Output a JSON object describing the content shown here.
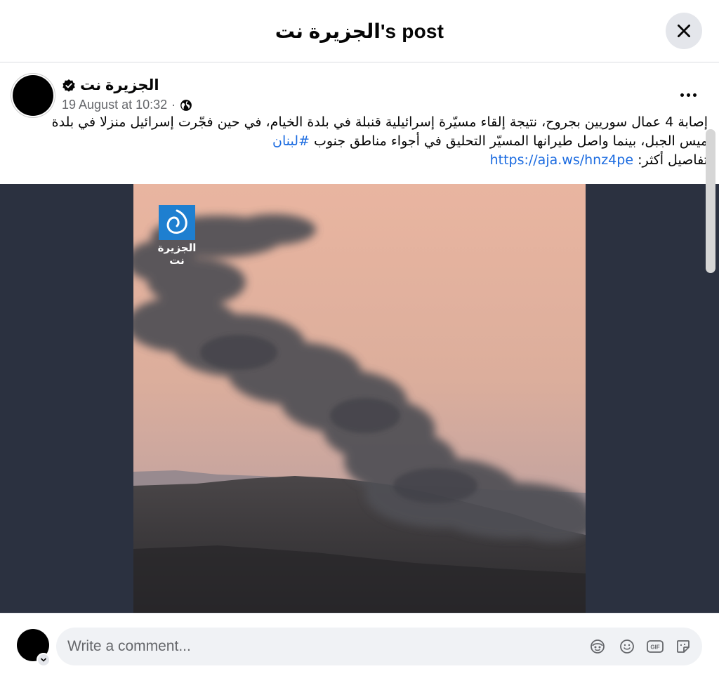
{
  "header": {
    "title": "الجزيرة نت's post",
    "close_icon": "close-icon"
  },
  "post": {
    "author": "الجزيرة نت",
    "verified_icon": "verified-badge-icon",
    "date": "19 August at 10:32",
    "separator": "·",
    "audience_icon": "globe-icon",
    "more_icon": "more-options-icon",
    "text_line1": "إصابة 4 عمال سوريين بجروح، نتيجة إلقاء مسيّرة إسرائيلية قنبلة في بلدة الخيام، في حين فجّرت إسرائيل منزلا في بلدة",
    "text_line2_pre": "ميس الجبل، بينما واصل طيرانها المسيّر التحليق في أجواء مناطق جنوب ",
    "hashtag": "#لبنان",
    "details_label": "تفاصيل أكثر: ",
    "link": "https://aja.ws/hnz4pe"
  },
  "media": {
    "logo_text": "الجزيرة نت",
    "accent_color": "#1e7fd0"
  },
  "comment": {
    "placeholder": "Write a comment...",
    "icons": [
      "avatar-sticker-icon",
      "emoji-icon",
      "gif-icon",
      "sticker-icon"
    ]
  },
  "colors": {
    "link": "#1b6be0",
    "media_background": "#2b3140",
    "input_background": "#f0f2f5"
  }
}
